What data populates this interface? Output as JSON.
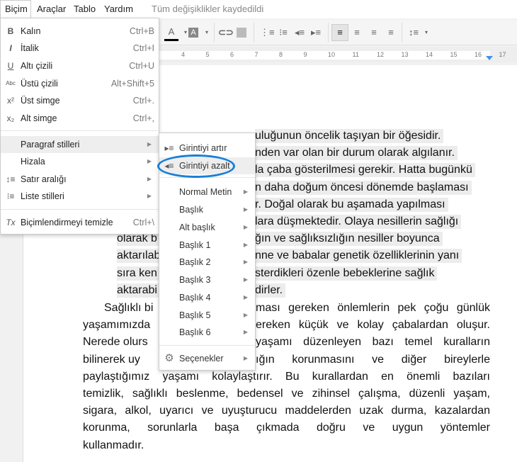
{
  "menubar": {
    "items": [
      "Biçim",
      "Araçlar",
      "Tablo",
      "Yardım"
    ],
    "status": "Tüm değişiklikler kaydedildi"
  },
  "toolbar": {
    "icons": [
      "text-color-icon",
      "highlight-color-icon",
      "link-icon",
      "image-icon",
      "numbered-list-icon",
      "bulleted-list-icon",
      "decrease-indent-icon",
      "increase-indent-icon",
      "align-left-icon",
      "align-center-icon",
      "align-right-icon",
      "justify-icon",
      "line-spacing-icon"
    ],
    "active": "align-left"
  },
  "ruler": {
    "numbers": [
      "4",
      "5",
      "6",
      "7",
      "8",
      "9",
      "10",
      "11",
      "12",
      "13",
      "14",
      "15",
      "16",
      "17"
    ]
  },
  "format_menu": {
    "items": [
      {
        "label": "Kalın",
        "shortcut": "Ctrl+B",
        "icon": "B"
      },
      {
        "label": "İtalik",
        "shortcut": "Ctrl+I",
        "icon": "I"
      },
      {
        "label": "Altı çizili",
        "shortcut": "Ctrl+U",
        "icon": "U"
      },
      {
        "label": "Üstü çizili",
        "shortcut": "Alt+Shift+5",
        "icon": "Abc"
      },
      {
        "label": "Üst simge",
        "shortcut": "Ctrl+.",
        "icon": "x²"
      },
      {
        "label": "Alt simge",
        "shortcut": "Ctrl+,",
        "icon": "x₂"
      },
      {
        "label": "Paragraf stilleri"
      },
      {
        "label": "Hizala"
      },
      {
        "label": "Satır aralığı",
        "icon": "↕≡"
      },
      {
        "label": "Liste stilleri",
        "icon": "⁝≡"
      },
      {
        "label": "Biçimlendirmeyi temizle",
        "shortcut": "Ctrl+\\",
        "icon": "Tx"
      }
    ]
  },
  "submenu": {
    "items": [
      "Girintiyi artır",
      "Girintiyi azalt",
      "Normal Metin",
      "Başlık",
      "Alt başlık",
      "Başlık 1",
      "Başlık 2",
      "Başlık 3",
      "Başlık 4",
      "Başlık 5",
      "Başlık 6",
      "Seçenekler"
    ]
  },
  "document": {
    "p1_right": [
      "uluğunun öncelik taşıyan bir öğesidir.",
      "nden var olan bir durum olarak algılanır.",
      "la çaba gösterilmesi gerekir. Hatta bugünkü",
      "n daha doğum öncesi dönemde başlaması",
      "r. Doğal olarak bu aşamada yapılması",
      "lara düşmektedir. Olaya nesillerin sağlığı",
      "ğın ve sağlıksızlığın nesiller boyunca",
      "nne ve babalar genetik özelliklerinin yanı",
      "sterdikleri özenle bebeklerine sağlık",
      "dirler."
    ],
    "p1_left": [
      "olarak b",
      "aktarılab",
      "sıra ken",
      "aktarabi"
    ],
    "p2_left": [
      "Sağlıklı bi",
      "yaşamımızda",
      "Nerede olurs",
      "bilinerek uy"
    ],
    "p2_right": [
      "ması gereken önlemlerin pek çoğu günlük",
      "ereken küçük ve kolay çabalardan oluşur.",
      "yaşamı düzenleyen bazı temel kuralların",
      "ığın korunmasını ve diğer bireylerle"
    ],
    "p2_full": [
      "paylaştığımız yaşamı kolaylaştırır. Bu kurallardan en önemli bazıları",
      "temizlik, sağlıklı beslenme, bedensel ve zihinsel çalışma, düzenli yaşam,",
      "sigara, alkol, uyarıcı ve uyuşturucu maddelerden uzak durma, kazalardan",
      "korunma, sorunlarla başa çıkmada doğru ve uygun yöntemler",
      "kullanmadır."
    ]
  },
  "annotation": {
    "color": "#1a7fd6",
    "target": "Girintiyi azalt"
  }
}
